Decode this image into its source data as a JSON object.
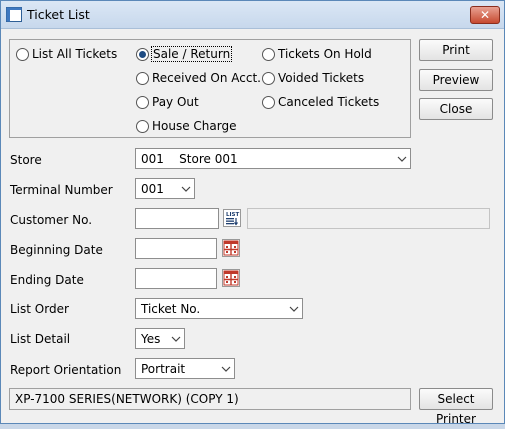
{
  "window": {
    "title": "Ticket List",
    "close_glyph": "✕"
  },
  "report_type": {
    "options": [
      {
        "label": "List All Tickets",
        "checked": false
      },
      {
        "label": "Sale / Return",
        "checked": true
      },
      {
        "label": "Tickets On Hold",
        "checked": false
      },
      {
        "label": "Received On Acct.",
        "checked": false
      },
      {
        "label": "Voided Tickets",
        "checked": false
      },
      {
        "label": "Pay Out",
        "checked": false
      },
      {
        "label": "Canceled Tickets",
        "checked": false
      },
      {
        "label": "House Charge",
        "checked": false
      }
    ]
  },
  "buttons": {
    "print": "Print",
    "preview": "Preview",
    "close": "Close",
    "select_printer": "Select Printer"
  },
  "fields": {
    "store": {
      "label": "Store",
      "value": "001    Store 001"
    },
    "terminal": {
      "label": "Terminal Number",
      "value": "001"
    },
    "customer": {
      "label": "Customer No.",
      "value": "",
      "name": ""
    },
    "begin_date": {
      "label": "Beginning Date",
      "value": ""
    },
    "end_date": {
      "label": "Ending Date",
      "value": ""
    },
    "list_order": {
      "label": "List Order",
      "value": "Ticket No."
    },
    "list_detail": {
      "label": "List Detail",
      "value": "Yes"
    },
    "orientation": {
      "label": "Report Orientation",
      "value": "Portrait"
    }
  },
  "printer": {
    "name": "XP-7100 SERIES(NETWORK) (COPY 1)"
  },
  "colors": {
    "calendar_accent": "#c0392b",
    "radio_selected": "#1e4b82",
    "close_button": "#c74a30"
  },
  "icons": {
    "list_button": "list-lookup-icon",
    "calendar": "calendar-icon",
    "dropdown": "chevron-down-icon"
  }
}
